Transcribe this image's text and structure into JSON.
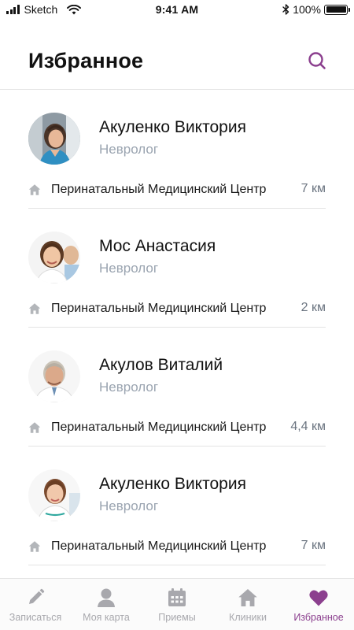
{
  "status_bar": {
    "carrier": "Sketch",
    "time": "9:41 AM",
    "battery": "100%",
    "battery_level": 1.0
  },
  "header": {
    "title": "Избранное",
    "search_icon": "search-icon"
  },
  "favorites": [
    {
      "name": "Акуленко Виктория",
      "specialty": "Невролог",
      "clinic": "Перинатальный Медицинский Центр",
      "distance": "7 км"
    },
    {
      "name": "Мос Анастасия",
      "specialty": "Невролог",
      "clinic": "Перинатальный Медицинский Центр",
      "distance": "2 км"
    },
    {
      "name": "Акулов Виталий",
      "specialty": "Невролог",
      "clinic": "Перинатальный Медицинский Центр",
      "distance": "4,4 км"
    },
    {
      "name": "Акуленко Виктория",
      "specialty": "Невролог",
      "clinic": "Перинатальный Медицинский Центр",
      "distance": "7 км"
    }
  ],
  "tabbar": {
    "tabs": [
      {
        "label": "Записаться",
        "icon": "pencil-icon",
        "active": false
      },
      {
        "label": "Моя карта",
        "icon": "person-icon",
        "active": false
      },
      {
        "label": "Приемы",
        "icon": "calendar-icon",
        "active": false
      },
      {
        "label": "Клиники",
        "icon": "home-icon",
        "active": false
      },
      {
        "label": "Избранное",
        "icon": "heart-icon",
        "active": true
      }
    ]
  },
  "colors": {
    "accent": "#8b3f8e",
    "inactive_tab": "#a8a8ad",
    "secondary_text": "#9aa4b0",
    "divider": "#e4e4e4"
  }
}
